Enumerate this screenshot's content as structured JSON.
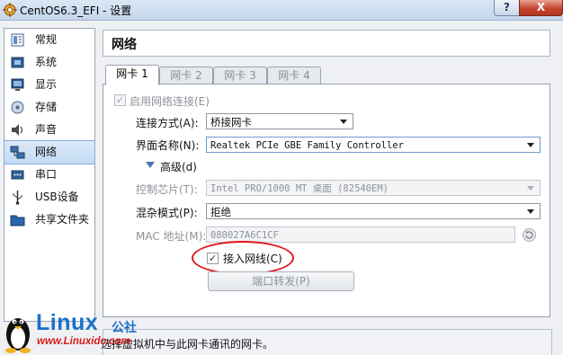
{
  "window": {
    "title": "CentOS6.3_EFI - 设置",
    "help_label": "?",
    "close_label": "X"
  },
  "sidebar": {
    "items": [
      {
        "label": "常规",
        "icon": "general-icon"
      },
      {
        "label": "系统",
        "icon": "system-icon"
      },
      {
        "label": "显示",
        "icon": "display-icon"
      },
      {
        "label": "存储",
        "icon": "storage-icon"
      },
      {
        "label": "声音",
        "icon": "audio-icon"
      },
      {
        "label": "网络",
        "icon": "network-icon",
        "selected": true
      },
      {
        "label": "串口",
        "icon": "serial-port-icon"
      },
      {
        "label": "USB设备",
        "icon": "usb-icon"
      },
      {
        "label": "共享文件夹",
        "icon": "shared-folder-icon"
      }
    ]
  },
  "section": {
    "title": "网络"
  },
  "tabs": [
    {
      "label": "网卡 1",
      "active": true
    },
    {
      "label": "网卡 2"
    },
    {
      "label": "网卡 3"
    },
    {
      "label": "网卡 4"
    }
  ],
  "adapter": {
    "enable_label": "启用网络连接(E)",
    "enable_checked": true,
    "attached_to_label": "连接方式(A):",
    "attached_to_value": "桥接网卡",
    "name_label": "界面名称(N):",
    "name_value": "Realtek PCIe GBE Family Controller",
    "advanced_label": "高级(d)",
    "chipset_label": "控制芯片(T):",
    "chipset_value": "Intel PRO/1000 MT 桌面 (82540EM)",
    "promisc_label": "混杂模式(P):",
    "promisc_value": "拒绝",
    "mac_label": "MAC 地址(M):",
    "mac_value": "080027A6C1CF",
    "cable_label": "接入网线(C)",
    "cable_checked": true,
    "port_forward_label": "端口转发(P)"
  },
  "status": {
    "text": "选择虚拟机中与此网卡通讯的网卡。"
  },
  "watermark": {
    "brand": "Linux",
    "brand_cn": "公社",
    "url": "www.Linuxidc.com"
  },
  "colors": {
    "accent": "#1b70c9",
    "highlight_circle": "#e2151b",
    "watermark_url": "#d51b1b"
  }
}
